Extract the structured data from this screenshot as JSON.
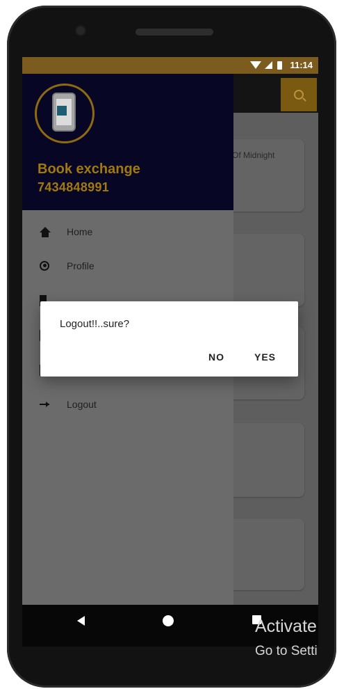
{
  "status_bar": {
    "time": "11:14"
  },
  "drawer": {
    "app_name": "Book exchange",
    "phone": "7434848991",
    "items": [
      {
        "label": "Home",
        "icon": "home-icon"
      },
      {
        "label": "Profile",
        "icon": "profile-icon"
      },
      {
        "label": "",
        "icon": "book-icon"
      },
      {
        "label": "",
        "icon": "book-icon"
      },
      {
        "label": "",
        "icon": "book-icon"
      },
      {
        "label": "Logout",
        "icon": "arrow-right-icon"
      }
    ]
  },
  "content": {
    "cards": [
      {
        "text": "Of Midnight"
      },
      {
        "text": ""
      },
      {
        "text": ""
      },
      {
        "text": ""
      },
      {
        "text": ""
      }
    ]
  },
  "dialog": {
    "message": "Logout!!..sure?",
    "no_label": "NO",
    "yes_label": "YES"
  },
  "watermark": {
    "title": "Activate",
    "subtitle": "Go to Setti"
  },
  "colors": {
    "status_bar": "#7c5b1e",
    "drawer_header": "#070725",
    "accent_gold": "#a2790f",
    "drawer_body": "#6b6b6b",
    "dialog_bg": "#ffffff"
  }
}
